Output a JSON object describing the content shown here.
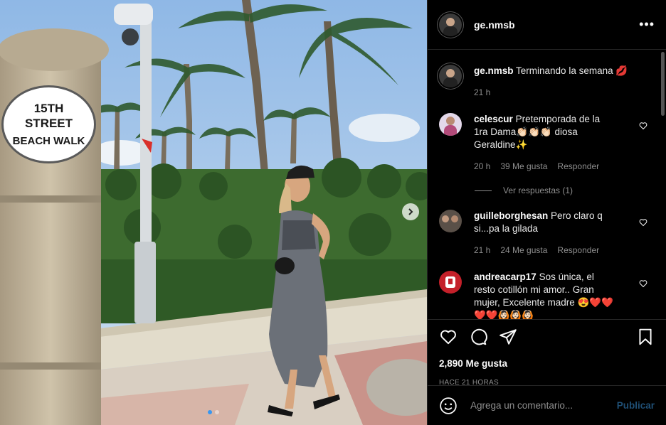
{
  "photo": {
    "sign_line1": "15TH",
    "sign_line2": "STREET",
    "sign_line3": "BEACH WALK",
    "carousel_count": 2,
    "carousel_active": 1
  },
  "header": {
    "username": "ge.nmsb",
    "more": "•••"
  },
  "caption": {
    "username": "ge.nmsb",
    "text": "Terminando la semana 💋",
    "time": "21 h"
  },
  "comments": [
    {
      "username": "celescur",
      "text": "Pretemporada de la 1ra Dama👏🏻👏🏻👏🏻 diosa Geraldine✨",
      "time": "20 h",
      "likes": "39 Me gusta",
      "reply": "Responder",
      "view_replies": "Ver respuestas (1)"
    },
    {
      "username": "guilleborghesan",
      "text": "Pero claro q si...pa la gilada",
      "time": "21 h",
      "likes": "24 Me gusta",
      "reply": "Responder"
    },
    {
      "username": "andreacarp17",
      "text": "Sos única, el resto cotillón mi amor.. Gran mujer, Excelente madre 😍❤️❤️❤️❤️🙆🏻🙆🏻🙆🏻"
    }
  ],
  "likes": "2,890 Me gusta",
  "time_ago": "HACE 21 HORAS",
  "add_comment": {
    "placeholder": "Agrega un comentario...",
    "publish": "Publicar"
  },
  "colors": {
    "accent": "#3897f0",
    "publish_disabled": "#1f4f75",
    "border": "#262626",
    "muted": "#8e8e8e"
  }
}
